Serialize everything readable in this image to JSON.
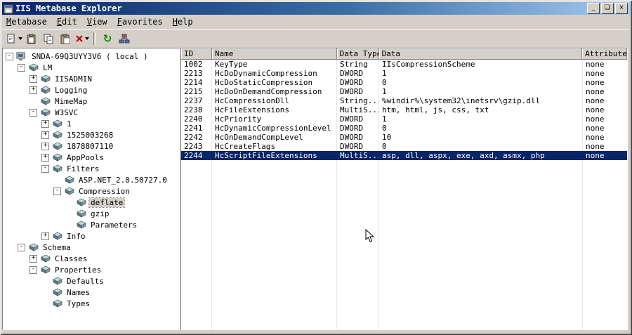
{
  "window": {
    "title": "IIS Metabase Explorer",
    "controls": {
      "minimize": "_",
      "maximize": "❏",
      "close": "×"
    }
  },
  "menu": {
    "items": [
      "Metabase",
      "Edit",
      "View",
      "Favorites",
      "Help"
    ]
  },
  "toolbar": {
    "buttons": [
      "new-key-button",
      "paste-key-button",
      "copy-button",
      "paste-button",
      "delete-button",
      "refresh-button",
      "connect-network-button"
    ],
    "refresh_glyph": "↻"
  },
  "tree": {
    "items": [
      {
        "label": "SNDA-69Q3UYY3V6 ( local )",
        "level": 0,
        "expander": "minus",
        "icon": "computer",
        "selected": false
      },
      {
        "label": "LM",
        "level": 1,
        "expander": "minus",
        "icon": "key",
        "selected": false
      },
      {
        "label": "IISADMIN",
        "level": 2,
        "expander": "plus",
        "icon": "key",
        "selected": false
      },
      {
        "label": "Logging",
        "level": 2,
        "expander": "plus",
        "icon": "key",
        "selected": false
      },
      {
        "label": "MimeMap",
        "level": 2,
        "expander": "none",
        "icon": "key",
        "selected": false
      },
      {
        "label": "W3SVC",
        "level": 2,
        "expander": "minus",
        "icon": "key",
        "selected": false
      },
      {
        "label": "1",
        "level": 3,
        "expander": "plus",
        "icon": "key",
        "selected": false
      },
      {
        "label": "1525003268",
        "level": 3,
        "expander": "plus",
        "icon": "key",
        "selected": false
      },
      {
        "label": "1878807110",
        "level": 3,
        "expander": "plus",
        "icon": "key",
        "selected": false
      },
      {
        "label": "AppPools",
        "level": 3,
        "expander": "plus",
        "icon": "key",
        "selected": false
      },
      {
        "label": "Filters",
        "level": 3,
        "expander": "minus",
        "icon": "key",
        "selected": false
      },
      {
        "label": "ASP.NET_2.0.50727.0",
        "level": 4,
        "expander": "none",
        "icon": "key",
        "selected": false
      },
      {
        "label": "Compression",
        "level": 4,
        "expander": "minus",
        "icon": "key",
        "selected": false
      },
      {
        "label": "deflate",
        "level": 5,
        "expander": "none",
        "icon": "key",
        "selected": true
      },
      {
        "label": "gzip",
        "level": 5,
        "expander": "none",
        "icon": "key",
        "selected": false
      },
      {
        "label": "Parameters",
        "level": 5,
        "expander": "none",
        "icon": "key",
        "selected": false
      },
      {
        "label": "Info",
        "level": 3,
        "expander": "plus",
        "icon": "key",
        "selected": false
      },
      {
        "label": "Schema",
        "level": 1,
        "expander": "minus",
        "icon": "key",
        "selected": false
      },
      {
        "label": "Classes",
        "level": 2,
        "expander": "plus",
        "icon": "key",
        "selected": false
      },
      {
        "label": "Properties",
        "level": 2,
        "expander": "minus",
        "icon": "key",
        "selected": false
      },
      {
        "label": "Defaults",
        "level": 3,
        "expander": "none",
        "icon": "key",
        "selected": false
      },
      {
        "label": "Names",
        "level": 3,
        "expander": "none",
        "icon": "key",
        "selected": false
      },
      {
        "label": "Types",
        "level": 3,
        "expander": "none",
        "icon": "key",
        "selected": false
      }
    ]
  },
  "list": {
    "columns": [
      "ID",
      "Name",
      "Data Type",
      "Data",
      "Attributes"
    ],
    "selected_row_index": 10,
    "rows": [
      [
        "1002",
        "KeyType",
        "String",
        "IIsCompressionScheme",
        "none"
      ],
      [
        "2213",
        "HcDoDynamicCompression",
        "DWORD",
        "1",
        "none"
      ],
      [
        "2214",
        "HcDoStaticCompression",
        "DWORD",
        "0",
        "none"
      ],
      [
        "2215",
        "HcDoOnDemandCompression",
        "DWORD",
        "1",
        "none"
      ],
      [
        "2237",
        "HcCompressionDll",
        "String...",
        "%windir%\\system32\\inetsrv\\gzip.dll",
        "none"
      ],
      [
        "2238",
        "HcFileExtensions",
        "MultiS...",
        "htm, html, js, css, txt",
        "none"
      ],
      [
        "2240",
        "HcPriority",
        "DWORD",
        "1",
        "none"
      ],
      [
        "2241",
        "HcDynamicCompressionLevel",
        "DWORD",
        "0",
        "none"
      ],
      [
        "2242",
        "HcOnDemandCompLevel",
        "DWORD",
        "10",
        "none"
      ],
      [
        "2243",
        "HcCreateFlags",
        "DWORD",
        "0",
        "none"
      ],
      [
        "2244",
        "HcScriptFileExtensions",
        "MultiS...",
        "asp, dll, aspx, exe, axd, asmx, php",
        "none"
      ]
    ]
  },
  "colors": {
    "titlebar_start": "#0a246a",
    "titlebar_end": "#a6caf0",
    "chrome": "#d4d0c8",
    "selection": "#0a246a",
    "inactive_selection": "#d4d0c8"
  }
}
